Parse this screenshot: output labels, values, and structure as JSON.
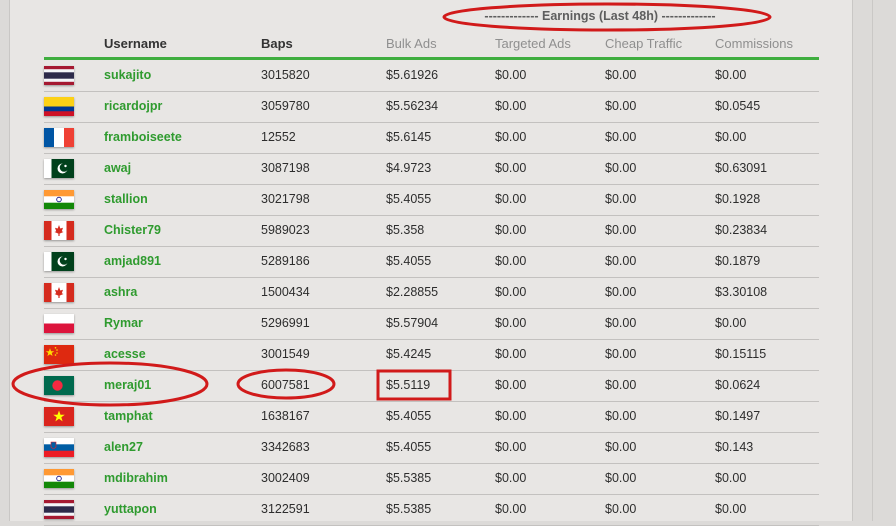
{
  "earnings_label": "------------- Earnings (Last 48h) -------------",
  "columns": {
    "username": "Username",
    "baps": "Baps",
    "bulk_ads": "Bulk Ads",
    "targeted_ads": "Targeted Ads",
    "cheap_traffic": "Cheap Traffic",
    "commissions": "Commissions"
  },
  "rows": [
    {
      "flag": "thailand-flag",
      "username": "sukajito",
      "baps": "3015820",
      "bulk_ads": "$5.61926",
      "targeted_ads": "$0.00",
      "cheap_traffic": "$0.00",
      "commissions": "$0.00"
    },
    {
      "flag": "colombia-flag",
      "username": "ricardojpr",
      "baps": "3059780",
      "bulk_ads": "$5.56234",
      "targeted_ads": "$0.00",
      "cheap_traffic": "$0.00",
      "commissions": "$0.0545"
    },
    {
      "flag": "france-flag",
      "username": "framboiseete",
      "baps": "12552",
      "bulk_ads": "$5.6145",
      "targeted_ads": "$0.00",
      "cheap_traffic": "$0.00",
      "commissions": "$0.00"
    },
    {
      "flag": "pakistan-flag",
      "username": "awaj",
      "baps": "3087198",
      "bulk_ads": "$4.9723",
      "targeted_ads": "$0.00",
      "cheap_traffic": "$0.00",
      "commissions": "$0.63091"
    },
    {
      "flag": "india-flag",
      "username": "stallion",
      "baps": "3021798",
      "bulk_ads": "$5.4055",
      "targeted_ads": "$0.00",
      "cheap_traffic": "$0.00",
      "commissions": "$0.1928"
    },
    {
      "flag": "canada-flag",
      "username": "Chister79",
      "baps": "5989023",
      "bulk_ads": "$5.358",
      "targeted_ads": "$0.00",
      "cheap_traffic": "$0.00",
      "commissions": "$0.23834"
    },
    {
      "flag": "pakistan-flag",
      "username": "amjad891",
      "baps": "5289186",
      "bulk_ads": "$5.4055",
      "targeted_ads": "$0.00",
      "cheap_traffic": "$0.00",
      "commissions": "$0.1879"
    },
    {
      "flag": "canada-flag",
      "username": "ashra",
      "baps": "1500434",
      "bulk_ads": "$2.28855",
      "targeted_ads": "$0.00",
      "cheap_traffic": "$0.00",
      "commissions": "$3.30108"
    },
    {
      "flag": "poland-flag",
      "username": "Rymar",
      "baps": "5296991",
      "bulk_ads": "$5.57904",
      "targeted_ads": "$0.00",
      "cheap_traffic": "$0.00",
      "commissions": "$0.00"
    },
    {
      "flag": "china-flag",
      "username": "acesse",
      "baps": "3001549",
      "bulk_ads": "$5.4245",
      "targeted_ads": "$0.00",
      "cheap_traffic": "$0.00",
      "commissions": "$0.15115"
    },
    {
      "flag": "bangladesh-flag",
      "username": "meraj01",
      "baps": "6007581",
      "bulk_ads": "$5.5119",
      "targeted_ads": "$0.00",
      "cheap_traffic": "$0.00",
      "commissions": "$0.0624"
    },
    {
      "flag": "vietnam-flag",
      "username": "tamphat",
      "baps": "1638167",
      "bulk_ads": "$5.4055",
      "targeted_ads": "$0.00",
      "cheap_traffic": "$0.00",
      "commissions": "$0.1497"
    },
    {
      "flag": "slovenia-flag",
      "username": "alen27",
      "baps": "3342683",
      "bulk_ads": "$5.4055",
      "targeted_ads": "$0.00",
      "cheap_traffic": "$0.00",
      "commissions": "$0.143"
    },
    {
      "flag": "india-flag",
      "username": "mdibrahim",
      "baps": "3002409",
      "bulk_ads": "$5.5385",
      "targeted_ads": "$0.00",
      "cheap_traffic": "$0.00",
      "commissions": "$0.00"
    },
    {
      "flag": "thailand-flag",
      "username": "yuttapon",
      "baps": "3122591",
      "bulk_ads": "$5.5385",
      "targeted_ads": "$0.00",
      "cheap_traffic": "$0.00",
      "commissions": "$0.00"
    }
  ],
  "colors": {
    "username_green": "#2f9b2f",
    "header_rule_green": "#3fae3f",
    "annotation_red": "#d11a1a"
  }
}
